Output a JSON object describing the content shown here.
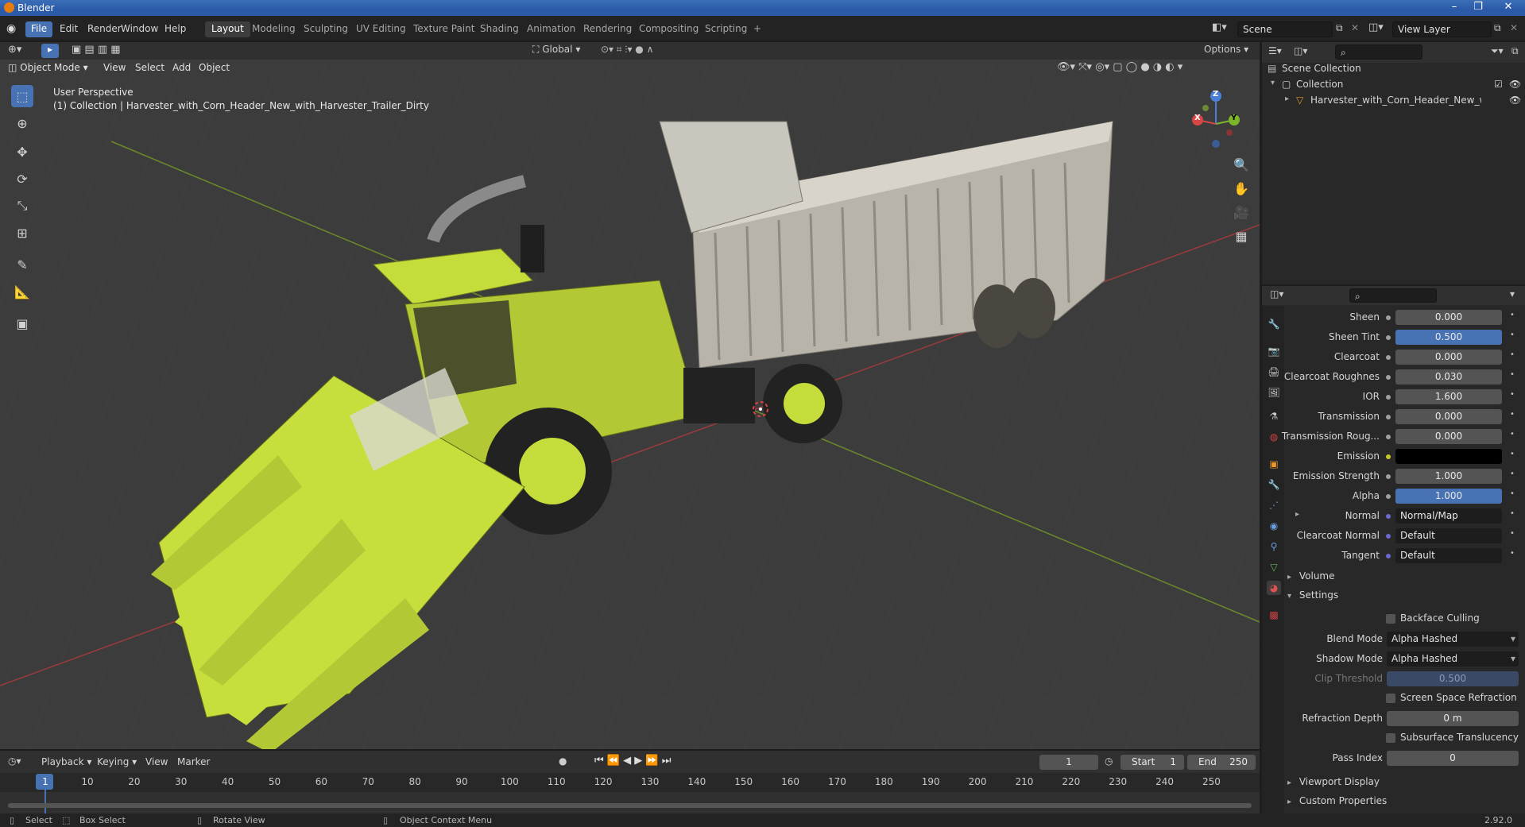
{
  "window": {
    "title": "Blender"
  },
  "menubar": {
    "items": [
      "File",
      "Edit",
      "Render",
      "Window",
      "Help"
    ],
    "workspaces": [
      "Layout",
      "Modeling",
      "Sculpting",
      "UV Editing",
      "Texture Paint",
      "Shading",
      "Animation",
      "Rendering",
      "Compositing",
      "Scripting"
    ],
    "add_tab": "+",
    "scene": "Scene",
    "view_layer": "View Layer"
  },
  "viewport": {
    "mode": "Object Mode",
    "menus": [
      "View",
      "Select",
      "Add",
      "Object"
    ],
    "orientation": "Global",
    "options": "Options",
    "perspective": "User Perspective",
    "collection_info": "(1) Collection | Harvester_with_Corn_Header_New_with_Harvester_Trailer_Dirty",
    "gizmo": {
      "z": "Z",
      "y": "Y",
      "x": "X"
    }
  },
  "outliner": {
    "search_placeholder": "",
    "items": [
      {
        "label": "Scene Collection"
      },
      {
        "label": "Collection"
      },
      {
        "label": "Harvester_with_Corn_Header_New_with"
      }
    ]
  },
  "properties": {
    "rows": [
      {
        "label": "Sheen",
        "value": "0.000",
        "style": "gray"
      },
      {
        "label": "Sheen Tint",
        "value": "0.500",
        "style": "blue"
      },
      {
        "label": "Clearcoat",
        "value": "0.000",
        "style": "gray"
      },
      {
        "label": "Clearcoat Roughnes",
        "value": "0.030",
        "style": "gray"
      },
      {
        "label": "IOR",
        "value": "1.600",
        "style": "gray"
      },
      {
        "label": "Transmission",
        "value": "0.000",
        "style": "gray"
      },
      {
        "label": "Transmission Roug...",
        "value": "0.000",
        "style": "gray"
      },
      {
        "label": "Emission",
        "value": "",
        "style": "black"
      },
      {
        "label": "Emission Strength",
        "value": "1.000",
        "style": "gray"
      },
      {
        "label": "Alpha",
        "value": "1.000",
        "style": "blue"
      },
      {
        "label": "Normal",
        "value": "Normal/Map",
        "style": "link"
      },
      {
        "label": "Clearcoat Normal",
        "value": "Default",
        "style": "link"
      },
      {
        "label": "Tangent",
        "value": "Default",
        "style": "link"
      }
    ],
    "panels": {
      "volume": "Volume",
      "settings": "Settings",
      "viewport_display": "Viewport Display",
      "custom_properties": "Custom Properties"
    },
    "settings": {
      "backface_culling": "Backface Culling",
      "blend_mode_label": "Blend Mode",
      "blend_mode": "Alpha Hashed",
      "shadow_mode_label": "Shadow Mode",
      "shadow_mode": "Alpha Hashed",
      "clip_threshold_label": "Clip Threshold",
      "clip_threshold": "0.500",
      "screen_space_refraction": "Screen Space Refraction",
      "refraction_depth_label": "Refraction Depth",
      "refraction_depth": "0 m",
      "subsurface_translucency": "Subsurface Translucency",
      "pass_index_label": "Pass Index",
      "pass_index": "0"
    }
  },
  "timeline": {
    "menus": [
      "Playback",
      "Keying",
      "View",
      "Marker"
    ],
    "current_frame": "1",
    "start_label": "Start",
    "start": "1",
    "end_label": "End",
    "end": "250",
    "ticks": [
      "1",
      "10",
      "20",
      "30",
      "40",
      "50",
      "60",
      "70",
      "80",
      "90",
      "100",
      "110",
      "120",
      "130",
      "140",
      "150",
      "160",
      "170",
      "180",
      "190",
      "200",
      "210",
      "220",
      "230",
      "240",
      "250"
    ]
  },
  "statusbar": {
    "select": "Select",
    "box_select": "Box Select",
    "rotate_view": "Rotate View",
    "context_menu": "Object Context Menu",
    "version": "2.92.0"
  },
  "colors": {
    "accent": "#4772b3",
    "harvester": "#c5dc3a",
    "trailer": "#a8a49a",
    "background": "#3c3c3c"
  }
}
